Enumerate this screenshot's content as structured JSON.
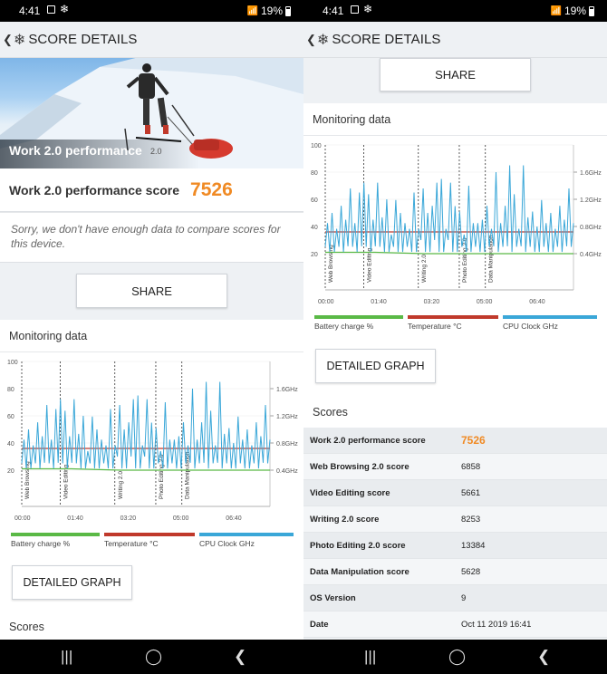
{
  "status": {
    "time": "4:41",
    "battery": "19%"
  },
  "app": {
    "title": "SCORE DETAILS"
  },
  "hero": {
    "label": "Work 2.0 performance",
    "version": "2.0"
  },
  "score": {
    "label": "Work 2.0 performance score",
    "value": "7526"
  },
  "notice": "Sorry, we don't have enough data to compare scores for this device.",
  "share_label": "SHARE",
  "monitoring_title": "Monitoring data",
  "detailed_graph_label": "DETAILED GRAPH",
  "scores_title": "Scores",
  "legend": [
    {
      "label": "Battery charge %",
      "color": "#5ab946"
    },
    {
      "label": "Temperature °C",
      "color": "#c0392b"
    },
    {
      "label": "CPU Clock GHz",
      "color": "#3aa7d8"
    }
  ],
  "chart_data": {
    "type": "line",
    "x_ticks": [
      "00:00",
      "01:40",
      "03:20",
      "05:00",
      "06:40"
    ],
    "y_left_ticks": [
      "20",
      "40",
      "60",
      "80",
      "100"
    ],
    "y_right_ticks": [
      "0.4GHz",
      "0.8GHz",
      "1.2GHz",
      "1.6GHz"
    ],
    "phases": [
      "Web Browsing",
      "Video Editing",
      "Writing 2.0",
      "Photo Editing 2.0",
      "Data Manipulation"
    ],
    "series": [
      {
        "name": "Battery charge %",
        "values": [
          21,
          21,
          20,
          20,
          20,
          20
        ]
      },
      {
        "name": "Temperature °C",
        "values": [
          36,
          36,
          36,
          36,
          36,
          36
        ]
      },
      {
        "name": "CPU Clock GHz",
        "values": [
          0.5,
          1.7,
          0.5,
          0.9,
          0.5,
          1.5,
          0.6,
          1.0,
          0.5,
          1.3,
          0.5,
          0.8,
          0.5,
          1.6,
          0.5,
          1.1,
          0.6,
          1.3,
          0.5,
          0.9,
          0.5,
          1.0,
          0.5,
          1.7,
          0.5,
          1.4,
          0.6,
          1.0,
          0.5,
          1.2,
          0.5,
          0.9
        ]
      }
    ]
  },
  "scores": [
    {
      "key": "Work 2.0 performance score",
      "value": "7526"
    },
    {
      "key": "Web Browsing 2.0 score",
      "value": "6858"
    },
    {
      "key": "Video Editing score",
      "value": "5661"
    },
    {
      "key": "Writing 2.0 score",
      "value": "8253"
    },
    {
      "key": "Photo Editing 2.0 score",
      "value": "13384"
    },
    {
      "key": "Data Manipulation score",
      "value": "5628"
    },
    {
      "key": "OS Version",
      "value": "9"
    },
    {
      "key": "Date",
      "value": "Oct 11 2019 16:41"
    }
  ]
}
